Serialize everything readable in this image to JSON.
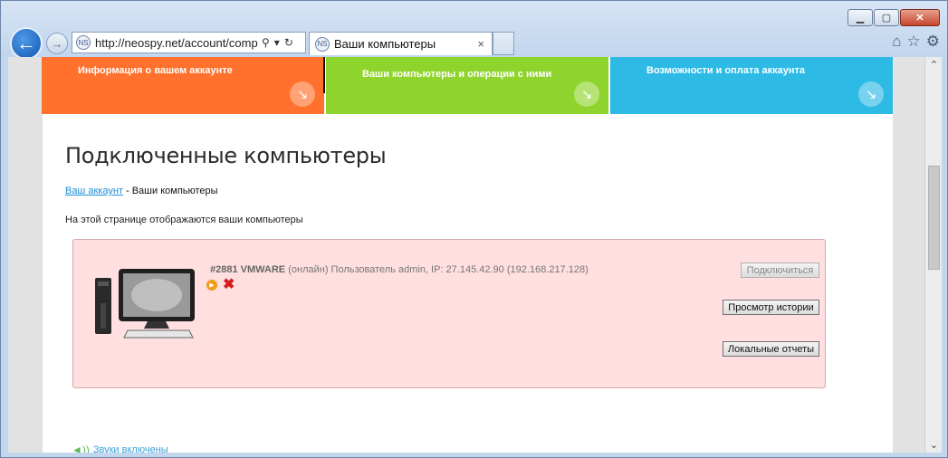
{
  "browser": {
    "address_url": "http://neospy.net/account/comp",
    "tab_title": "Ваши компьютеры",
    "tab_close": "×",
    "site_icon": "ns-logo-icon",
    "window_controls": [
      "minimize-icon",
      "maximize-icon",
      "close-icon"
    ],
    "toolbar_icons": [
      "home-icon",
      "favorites-icon",
      "settings-icon"
    ]
  },
  "nav_tiles": [
    {
      "label": "Информация о вашем аккаунте",
      "color": "#ff712d"
    },
    {
      "label": "Ваши компьютеры и операции с ними",
      "color": "#8fd42d"
    },
    {
      "label": "Возможности и оплата аккаунта",
      "color": "#2dbbe6"
    }
  ],
  "page": {
    "title": "Подключенные компьютеры",
    "breadcrumb_link": "Ваш аккаунт",
    "breadcrumb_sep": " - ",
    "breadcrumb_current": "Ваши компьютеры",
    "description": "На этой странице отображаются ваши компьютеры"
  },
  "computer": {
    "id_name": "#2881 VMWARE",
    "details": " (онлайн) Пользователь admin, IP: 27.145.42.90 (192.168.217.128)",
    "connect_label": "Подключиться",
    "history_label": "Просмотр истории",
    "reports_label": "Локальные отчеты",
    "box_color": "#ffdfe0"
  },
  "footer": {
    "sounds_label": "Звуки включены"
  }
}
